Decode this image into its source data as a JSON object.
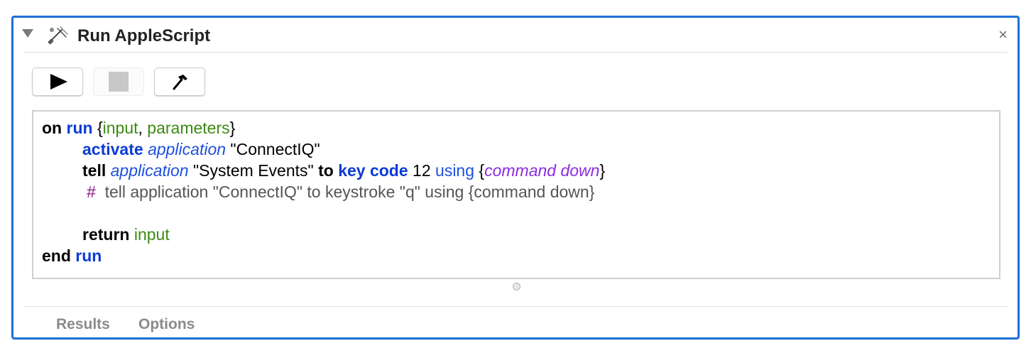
{
  "action": {
    "title": "Run AppleScript",
    "icon": "applescript-action-icon",
    "close": "×"
  },
  "toolbar": {
    "run_icon": "play-icon",
    "stop_icon": "stop-icon",
    "compile_icon": "hammer-icon"
  },
  "script": {
    "line1": {
      "on": "on",
      "run": "run",
      "open": "{",
      "input": "input",
      "comma": ", ",
      "parameters": "parameters",
      "close": "}"
    },
    "line2": {
      "activate": "activate",
      "application": "application",
      "target": "\"ConnectIQ\""
    },
    "line3": {
      "tell": "tell",
      "application": "application",
      "target": "\"System Events\"",
      "to": "to",
      "keycode": "key code",
      "num": "12",
      "using": "using",
      "open": "{",
      "modifier": "command down",
      "close": "}"
    },
    "line4": {
      "hash": "#",
      "comment": "tell application \"ConnectIQ\" to keystroke \"q\" using {command down}"
    },
    "line6": {
      "return": "return",
      "input": "input"
    },
    "line7": {
      "end": "end",
      "run": "run"
    }
  },
  "tabs": [
    "Results",
    "Options"
  ],
  "colors": {
    "accent_border": "#1f6fd6",
    "keyword_blue": "#0a3bd6",
    "variable_green": "#3c8a14",
    "parameter_purple": "#8a2be2",
    "comment_gray": "#555555"
  }
}
